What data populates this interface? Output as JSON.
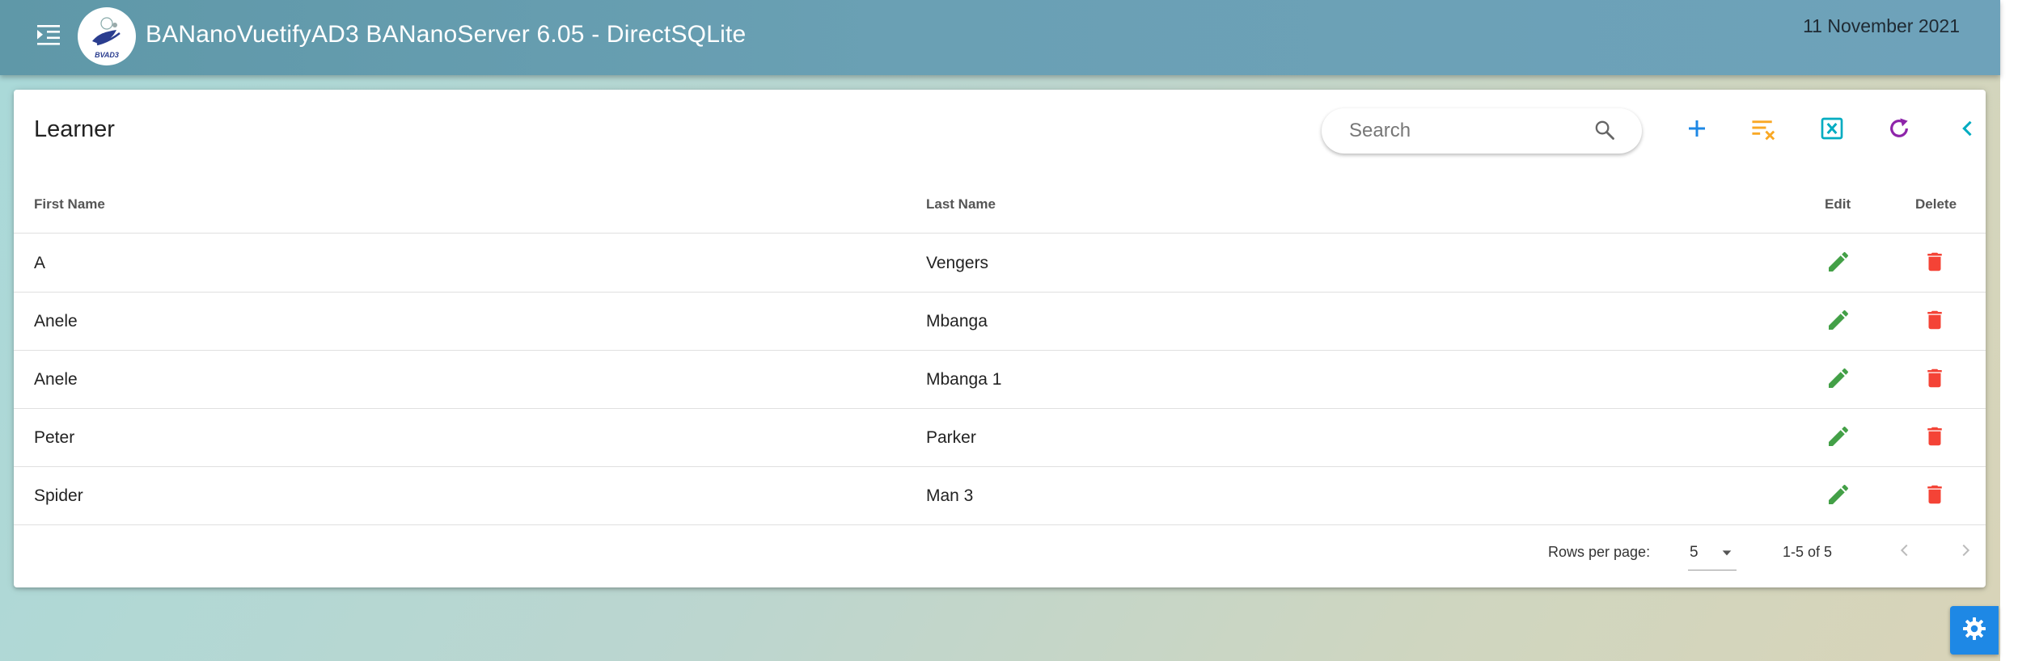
{
  "app_bar": {
    "title": "BANanoVuetifyAD3 BANanoServer 6.05 - DirectSQLite",
    "date": "11 November 2021",
    "logo_text": "BVAD3",
    "icons": {
      "menu": "menu-open-icon"
    }
  },
  "card": {
    "title": "Learner",
    "search": {
      "placeholder": "Search",
      "value": ""
    },
    "toolbar": [
      {
        "name": "add-button",
        "icon": "plus-icon",
        "color": "#1e88e5"
      },
      {
        "name": "clear-filter-button",
        "icon": "filter-remove-icon",
        "color": "#f9a825"
      },
      {
        "name": "export-excel-button",
        "icon": "excel-icon",
        "color": "#00acc1"
      },
      {
        "name": "refresh-button",
        "icon": "refresh-icon",
        "color": "#8e24aa"
      },
      {
        "name": "back-button",
        "icon": "chevron-left-icon",
        "color": "#00acc1"
      }
    ]
  },
  "table": {
    "headers": {
      "first_name": "First Name",
      "last_name": "Last Name",
      "edit": "Edit",
      "delete": "Delete"
    },
    "rows": [
      {
        "first_name": "A",
        "last_name": "Vengers"
      },
      {
        "first_name": "Anele",
        "last_name": "Mbanga"
      },
      {
        "first_name": "Anele",
        "last_name": "Mbanga 1"
      },
      {
        "first_name": "Peter",
        "last_name": "Parker"
      },
      {
        "first_name": "Spider",
        "last_name": "Man 3"
      }
    ],
    "edit_color": "#43a047",
    "delete_color": "#f44336"
  },
  "footer": {
    "rows_per_page_label": "Rows per page:",
    "rows_per_page_value": "5",
    "page_info": "1-5 of 5"
  },
  "fab": {
    "icon": "gear-icon",
    "color": "#1e88e5"
  }
}
